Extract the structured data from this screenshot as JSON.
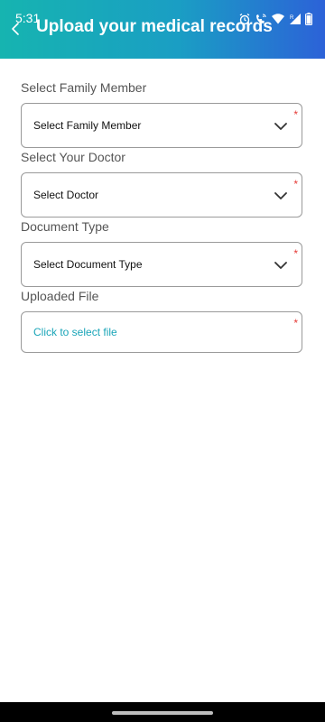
{
  "status_bar": {
    "time": "5:31",
    "icons": [
      "alarm-icon",
      "phone-wifi-icon",
      "wifi-icon",
      "signal-icon",
      "battery-icon"
    ]
  },
  "header": {
    "back_icon": "chevron-left-icon",
    "title": "Upload your medical records",
    "gradient": [
      "#16b4b0",
      "#1a9ec4",
      "#2c62d8"
    ]
  },
  "form": {
    "family": {
      "label": "Select Family Member",
      "value": "Select Family Member",
      "required": "*"
    },
    "doctor": {
      "label": "Select Your Doctor",
      "value": "Select Doctor",
      "required": "*"
    },
    "document_type": {
      "label": "Document Type",
      "value": "Select Document Type",
      "required": "*"
    },
    "file": {
      "label": "Uploaded File",
      "value": "Click to select file",
      "required": "*"
    }
  },
  "colors": {
    "required": "#e53935",
    "link": "#1aa5b8",
    "border": "#9a9a9a"
  }
}
